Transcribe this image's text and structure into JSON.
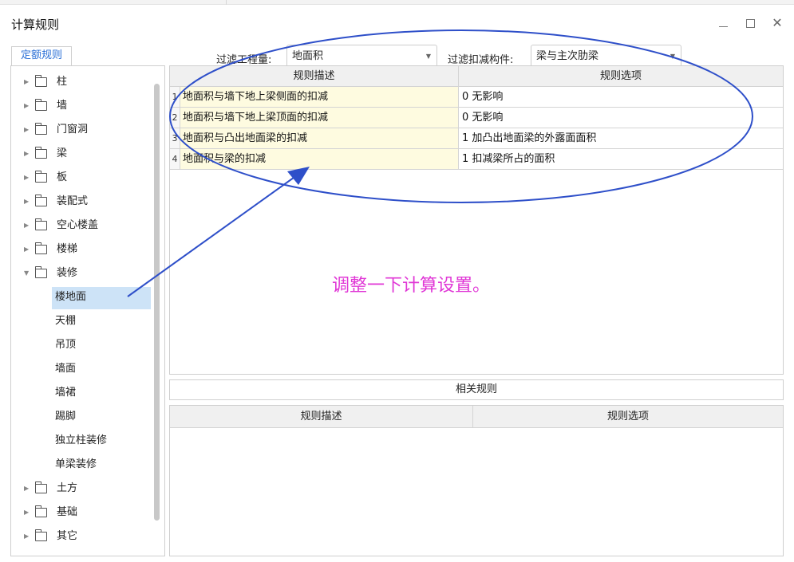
{
  "window": {
    "title": "计算规则",
    "minimize_icon": "minimize-icon",
    "maximize_icon": "maximize-icon",
    "close_icon": "close-icon"
  },
  "tab": {
    "label": "定额规则"
  },
  "filters": {
    "project_label": "过滤工程量:",
    "project_value": "地面积",
    "component_label": "过滤扣减构件:",
    "component_value": "梁与主次肋梁"
  },
  "tree": {
    "items": [
      {
        "label": "柱",
        "expanded": false
      },
      {
        "label": "墙",
        "expanded": false
      },
      {
        "label": "门窗洞",
        "expanded": false
      },
      {
        "label": "梁",
        "expanded": false
      },
      {
        "label": "板",
        "expanded": false
      },
      {
        "label": "装配式",
        "expanded": false
      },
      {
        "label": "空心楼盖",
        "expanded": false
      },
      {
        "label": "楼梯",
        "expanded": false
      },
      {
        "label": "装修",
        "expanded": true
      }
    ],
    "children": [
      "楼地面",
      "天棚",
      "吊顶",
      "墙面",
      "墙裙",
      "踢脚",
      "独立柱装修",
      "单梁装修"
    ],
    "selected_child": "楼地面",
    "after_items": [
      {
        "label": "土方",
        "expanded": false
      },
      {
        "label": "基础",
        "expanded": false
      },
      {
        "label": "其它",
        "expanded": false
      }
    ]
  },
  "grid": {
    "headers": [
      "规则描述",
      "规则选项"
    ],
    "rows": [
      {
        "num": "1",
        "desc": "地面积与墙下地上梁侧面的扣减",
        "option": "0  无影响"
      },
      {
        "num": "2",
        "desc": "地面积与墙下地上梁顶面的扣减",
        "option": "0  无影响"
      },
      {
        "num": "3",
        "desc": "地面积与凸出地面梁的扣减",
        "option": "1 加凸出地面梁的外露面面积"
      },
      {
        "num": "4",
        "desc": "地面积与梁的扣减",
        "option": "1 扣减梁所占的面积"
      }
    ]
  },
  "related": {
    "button_label": "相关规则",
    "headers": [
      "规则描述",
      "规则选项"
    ]
  },
  "annotation": {
    "text": "调整一下计算设置。",
    "color": "#e037d6",
    "stroke_color": "#2e4fc9"
  },
  "colors": {
    "tab_text": "#2a6fd6",
    "selected_bg": "#cde3f7",
    "desc_cell_bg": "#fefbe0"
  }
}
